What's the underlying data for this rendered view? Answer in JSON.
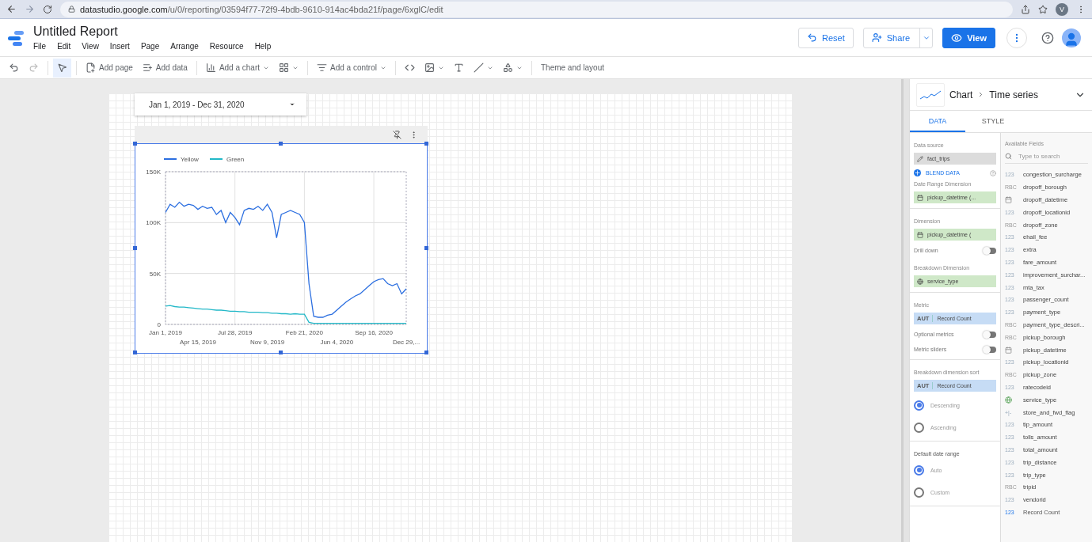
{
  "browser": {
    "url_host": "datastudio.google.com",
    "url_path": "/u/0/reporting/03594f77-72f9-4bdb-9610-914ac4bda21f/page/6xglC/edit",
    "profile_initial": "V"
  },
  "app": {
    "title": "Untitled Report",
    "menu": [
      "File",
      "Edit",
      "View",
      "Insert",
      "Page",
      "Arrange",
      "Resource",
      "Help"
    ],
    "buttons": [
      {
        "kind": "reset",
        "label": "Reset"
      },
      {
        "kind": "share",
        "label": "Share"
      },
      {
        "kind": "view",
        "label": "View"
      }
    ]
  },
  "toolbar": [
    {
      "kind": "undo"
    },
    {
      "kind": "redo",
      "disabled": true
    },
    {
      "kind": "select",
      "selected": true
    },
    {
      "kind": "addpage",
      "label": "Add page"
    },
    {
      "kind": "adddata",
      "label": "Add data"
    },
    {
      "kind": "addchart",
      "label": "Add a chart",
      "dropdown": true
    },
    {
      "kind": "community",
      "dropdown": true
    },
    {
      "kind": "addcontrol",
      "label": "Add a control",
      "dropdown": true
    },
    {
      "kind": "code"
    },
    {
      "kind": "image",
      "dropdown": true
    },
    {
      "kind": "text"
    },
    {
      "kind": "line",
      "dropdown": true
    },
    {
      "kind": "shape",
      "dropdown": true
    },
    {
      "kind": "theme",
      "label": "Theme and layout"
    }
  ],
  "canvas": {
    "date_range": "Jan 1, 2019 - Dec 31, 2020",
    "chart_data": {
      "type": "line",
      "categories": [
        "Jan 1, 2019",
        null,
        null,
        null,
        null,
        null,
        null,
        "Apr 15, 2019",
        null,
        null,
        null,
        null,
        null,
        null,
        null,
        "Jul 28, 2019",
        null,
        null,
        null,
        null,
        null,
        null,
        "Nov 9, 2019",
        null,
        null,
        null,
        null,
        null,
        null,
        null,
        "Feb 21, 2020",
        null,
        null,
        null,
        null,
        null,
        null,
        "Jun 4, 2020",
        null,
        null,
        null,
        null,
        null,
        null,
        null,
        "Sep 16, 2020",
        null,
        null,
        null,
        null,
        null,
        null,
        "Dec 29,..."
      ],
      "series": [
        {
          "name": "Yellow",
          "color": "#2c6fe0",
          "values": [
            110000,
            118000,
            115000,
            120000,
            116000,
            118000,
            117000,
            113000,
            116000,
            114000,
            115000,
            108000,
            112000,
            100000,
            110000,
            105000,
            98000,
            112000,
            114000,
            113000,
            116000,
            112000,
            118000,
            110000,
            85000,
            108000,
            110000,
            112000,
            110000,
            108000,
            100000,
            40000,
            8000,
            7000,
            7000,
            9000,
            10000,
            14000,
            18000,
            22000,
            25000,
            28000,
            30000,
            34000,
            38000,
            42000,
            44000,
            45000,
            40000,
            38000,
            40000,
            30000,
            35000
          ]
        },
        {
          "name": "Green",
          "color": "#22b8c8",
          "values": [
            18000,
            18500,
            17500,
            17000,
            17000,
            16500,
            16000,
            15500,
            15000,
            15000,
            14500,
            14000,
            14000,
            13500,
            13000,
            13000,
            12500,
            12500,
            12000,
            12000,
            12000,
            11500,
            11500,
            11000,
            11000,
            10500,
            10500,
            10000,
            10500,
            10000,
            10000,
            2000,
            1000,
            1000,
            1000,
            1000,
            1000,
            1000,
            1000,
            1000,
            1000,
            1000,
            1000,
            1000,
            1000,
            1000,
            1000,
            1000,
            1000,
            1000,
            1000,
            1000,
            1000
          ]
        }
      ],
      "grid": true,
      "legend": "top",
      "ylim": [
        0,
        150000
      ],
      "yticks": [
        {
          "value": 0,
          "label": "0"
        },
        {
          "value": 50000,
          "label": "50K"
        },
        {
          "value": 100000,
          "label": "100K"
        },
        {
          "value": 150000,
          "label": "150K"
        }
      ]
    }
  },
  "panel": {
    "breadcrumb": [
      "Chart",
      "Time series"
    ],
    "tabs": [
      {
        "label": "DATA",
        "selected": true
      },
      {
        "label": "STYLE",
        "selected": false
      }
    ],
    "data_source_label": "Data source",
    "data_source": "fact_trips",
    "blend": "BLEND DATA",
    "sections": [
      {
        "items": [
          {
            "kind": "label",
            "text": "Date Range Dimension"
          },
          {
            "kind": "date_chip",
            "text": "pickup_datetime (..."
          }
        ]
      },
      {
        "items": [
          {
            "kind": "label",
            "text": "Dimension"
          },
          {
            "kind": "date_chip",
            "text": "pickup_datetime ("
          },
          {
            "kind": "toggle",
            "text": "Drill down",
            "on": false
          },
          {
            "kind": "label",
            "text": "Breakdown Dimension"
          },
          {
            "kind": "geo_chip",
            "text": "service_type"
          }
        ]
      },
      {
        "items": [
          {
            "kind": "label",
            "text": "Metric"
          },
          {
            "kind": "metric",
            "badge": "AUT",
            "text": "Record Count"
          },
          {
            "kind": "toggle",
            "text": "Optional metrics",
            "on": false
          },
          {
            "kind": "toggle",
            "text": "Metric sliders",
            "on": false
          }
        ]
      },
      {
        "items": [
          {
            "kind": "label",
            "text": "Breakdown dimension sort"
          },
          {
            "kind": "metric",
            "badge": "AUT",
            "text": "Record Count"
          },
          {
            "kind": "radio",
            "text": "Descending",
            "selected": true
          },
          {
            "kind": "radio",
            "text": "Ascending",
            "selected": false
          }
        ]
      },
      {
        "items": [
          {
            "kind": "label",
            "text": "Default date range",
            "strong": true
          },
          {
            "kind": "radio",
            "text": "Auto",
            "selected": true
          },
          {
            "kind": "radio",
            "text": "Custom",
            "selected": false
          }
        ]
      }
    ],
    "fields_title": "Available Fields",
    "search_placeholder": "Type to search",
    "fields": [
      {
        "kind": "number",
        "badge": "123",
        "name": "congestion_surcharge"
      },
      {
        "kind": "text",
        "badge": "RBC",
        "name": "dropoff_borough"
      },
      {
        "kind": "date",
        "name": "dropoff_datetime"
      },
      {
        "kind": "number",
        "badge": "123",
        "name": "dropoff_locationid"
      },
      {
        "kind": "text",
        "badge": "RBC",
        "name": "dropoff_zone"
      },
      {
        "kind": "number",
        "badge": "123",
        "name": "ehail_fee"
      },
      {
        "kind": "number",
        "badge": "123",
        "name": "extra"
      },
      {
        "kind": "number",
        "badge": "123",
        "name": "fare_amount"
      },
      {
        "kind": "number",
        "badge": "123",
        "name": "improvement_surchar..."
      },
      {
        "kind": "number",
        "badge": "123",
        "name": "mta_tax"
      },
      {
        "kind": "number",
        "badge": "123",
        "name": "passenger_count"
      },
      {
        "kind": "number",
        "badge": "123",
        "name": "payment_type"
      },
      {
        "kind": "text",
        "badge": "RBC",
        "name": "payment_type_descri..."
      },
      {
        "kind": "text",
        "badge": "RBC",
        "name": "pickup_borough"
      },
      {
        "kind": "date",
        "name": "pickup_datetime"
      },
      {
        "kind": "number",
        "badge": "123",
        "name": "pickup_locationid"
      },
      {
        "kind": "text",
        "badge": "RBC",
        "name": "pickup_zone"
      },
      {
        "kind": "number",
        "badge": "123",
        "name": "ratecodeid"
      },
      {
        "kind": "geo",
        "name": "service_type"
      },
      {
        "kind": "bool",
        "badge": "+|-",
        "name": "store_and_fwd_flag"
      },
      {
        "kind": "number",
        "badge": "123",
        "name": "tip_amount"
      },
      {
        "kind": "number",
        "badge": "123",
        "name": "tolls_amount"
      },
      {
        "kind": "number",
        "badge": "123",
        "name": "total_amount"
      },
      {
        "kind": "number",
        "badge": "123",
        "name": "trip_distance"
      },
      {
        "kind": "number",
        "badge": "123",
        "name": "trip_type"
      },
      {
        "kind": "text",
        "badge": "RBC",
        "name": "tripid"
      },
      {
        "kind": "number",
        "badge": "123",
        "name": "vendorid"
      },
      {
        "kind": "metric",
        "badge": "123",
        "name": "Record Count"
      }
    ]
  }
}
